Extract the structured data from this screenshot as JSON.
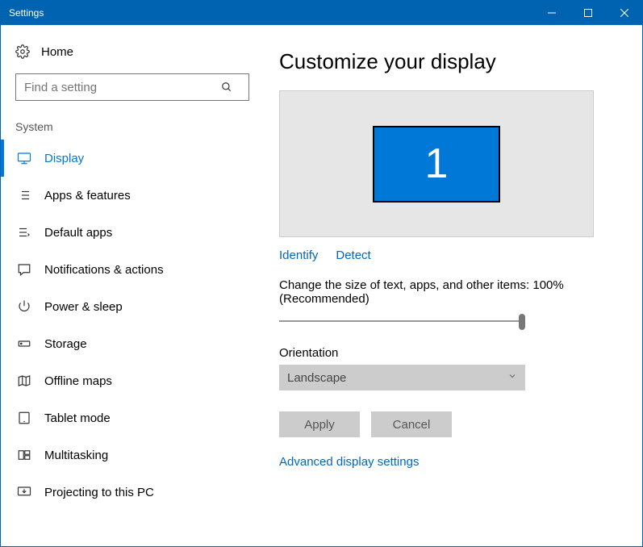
{
  "window": {
    "title": "Settings"
  },
  "home": {
    "label": "Home"
  },
  "search": {
    "placeholder": "Find a setting"
  },
  "category": "System",
  "nav": [
    {
      "id": "display",
      "label": "Display",
      "selected": true
    },
    {
      "id": "apps",
      "label": "Apps & features"
    },
    {
      "id": "default",
      "label": "Default apps"
    },
    {
      "id": "notif",
      "label": "Notifications & actions"
    },
    {
      "id": "power",
      "label": "Power & sleep"
    },
    {
      "id": "storage",
      "label": "Storage"
    },
    {
      "id": "maps",
      "label": "Offline maps"
    },
    {
      "id": "tablet",
      "label": "Tablet mode"
    },
    {
      "id": "multi",
      "label": "Multitasking"
    },
    {
      "id": "project",
      "label": "Projecting to this PC"
    }
  ],
  "main": {
    "heading": "Customize your display",
    "monitor_number": "1",
    "identify": "Identify",
    "detect": "Detect",
    "scale_label": "Change the size of text, apps, and other items: 100% (Recommended)",
    "orientation_label": "Orientation",
    "orientation_value": "Landscape",
    "apply": "Apply",
    "cancel": "Cancel",
    "advanced": "Advanced display settings"
  }
}
